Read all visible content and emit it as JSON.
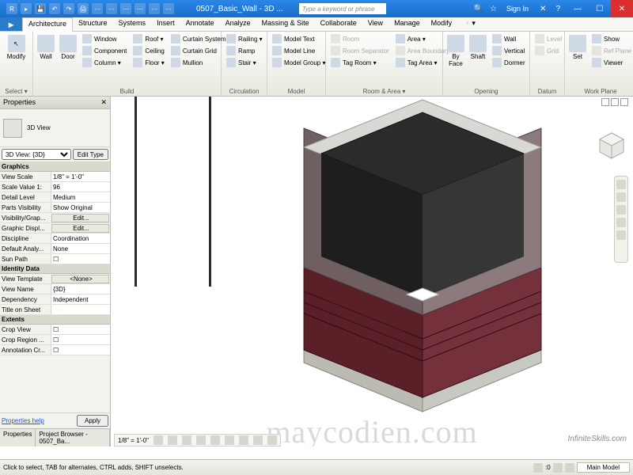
{
  "titlebar": {
    "app_title": "0507_Basic_Wall - 3D ...",
    "search_placeholder": "Type a keyword or phrase",
    "signin": "Sign In"
  },
  "tabs": [
    "Architecture",
    "Structure",
    "Systems",
    "Insert",
    "Annotate",
    "Analyze",
    "Massing & Site",
    "Collaborate",
    "View",
    "Manage",
    "Modify"
  ],
  "active_tab": "Architecture",
  "ribbon": {
    "select": {
      "modify": "Modify",
      "label": "Select ▾"
    },
    "build": {
      "wall": "Wall",
      "door": "Door",
      "items": [
        "Window",
        "Component",
        "Column ▾",
        "Roof ▾",
        "Ceiling",
        "Floor ▾",
        "Curtain System",
        "Curtain Grid",
        "Mullion"
      ],
      "label": "Build"
    },
    "circulation": {
      "items": [
        "Railing ▾",
        "Ramp",
        "Stair ▾"
      ],
      "label": "Circulation"
    },
    "model": {
      "items": [
        "Model Text",
        "Model Line",
        "Model Group ▾"
      ],
      "label": "Model"
    },
    "room_area": {
      "items_l": [
        "Room",
        "Room Separator",
        "Tag Room ▾"
      ],
      "items_r": [
        "Area ▾",
        "Area Boundary",
        "Tag Area ▾"
      ],
      "label": "Room & Area ▾"
    },
    "opening": {
      "byface": "By Face",
      "shaft": "Shaft",
      "items": [
        "Wall",
        "Vertical",
        "Dormer"
      ],
      "label": "Opening"
    },
    "datum": {
      "items": [
        "Level",
        "Grid"
      ],
      "label": "Datum"
    },
    "workplane": {
      "set": "Set",
      "items": [
        "Show",
        "Ref Plane",
        "Viewer"
      ],
      "label": "Work Plane"
    }
  },
  "properties": {
    "title": "Properties",
    "view_type": "3D View",
    "selector": "3D View: {3D}",
    "edit_type": "Edit Type",
    "groups": {
      "graphics": {
        "label": "Graphics",
        "rows": [
          {
            "k": "View Scale",
            "v": "1/8\" = 1'-0\""
          },
          {
            "k": "Scale Value 1:",
            "v": "96"
          },
          {
            "k": "Detail Level",
            "v": "Medium"
          },
          {
            "k": "Parts Visibility",
            "v": "Show Original"
          },
          {
            "k": "Visibility/Grap...",
            "v": "Edit...",
            "btn": true
          },
          {
            "k": "Graphic Displ...",
            "v": "Edit...",
            "btn": true
          },
          {
            "k": "Discipline",
            "v": "Coordination"
          },
          {
            "k": "Default Analy...",
            "v": "None"
          },
          {
            "k": "Sun Path",
            "v": "☐"
          }
        ]
      },
      "identity": {
        "label": "Identity Data",
        "rows": [
          {
            "k": "View Template",
            "v": "<None>",
            "btn": true
          },
          {
            "k": "View Name",
            "v": "{3D}"
          },
          {
            "k": "Dependency",
            "v": "Independent"
          },
          {
            "k": "Title on Sheet",
            "v": ""
          }
        ]
      },
      "extents": {
        "label": "Extents",
        "rows": [
          {
            "k": "Crop View",
            "v": "☐"
          },
          {
            "k": "Crop Region ...",
            "v": "☐"
          },
          {
            "k": "Annotation Cr...",
            "v": "☐"
          }
        ]
      }
    },
    "help": "Properties help",
    "apply": "Apply",
    "bottom_tabs": [
      "Properties",
      "Project Browser - 0507_Ba..."
    ]
  },
  "viewbar": {
    "scale": "1/8\" = 1'-0\""
  },
  "status": {
    "msg": "Click to select, TAB for alternates, CTRL adds, SHIFT unselects.",
    "main_model": "Main Model",
    "zero": ":0"
  },
  "watermark": "maycodien.com",
  "brand": "InfiniteSkills.com"
}
